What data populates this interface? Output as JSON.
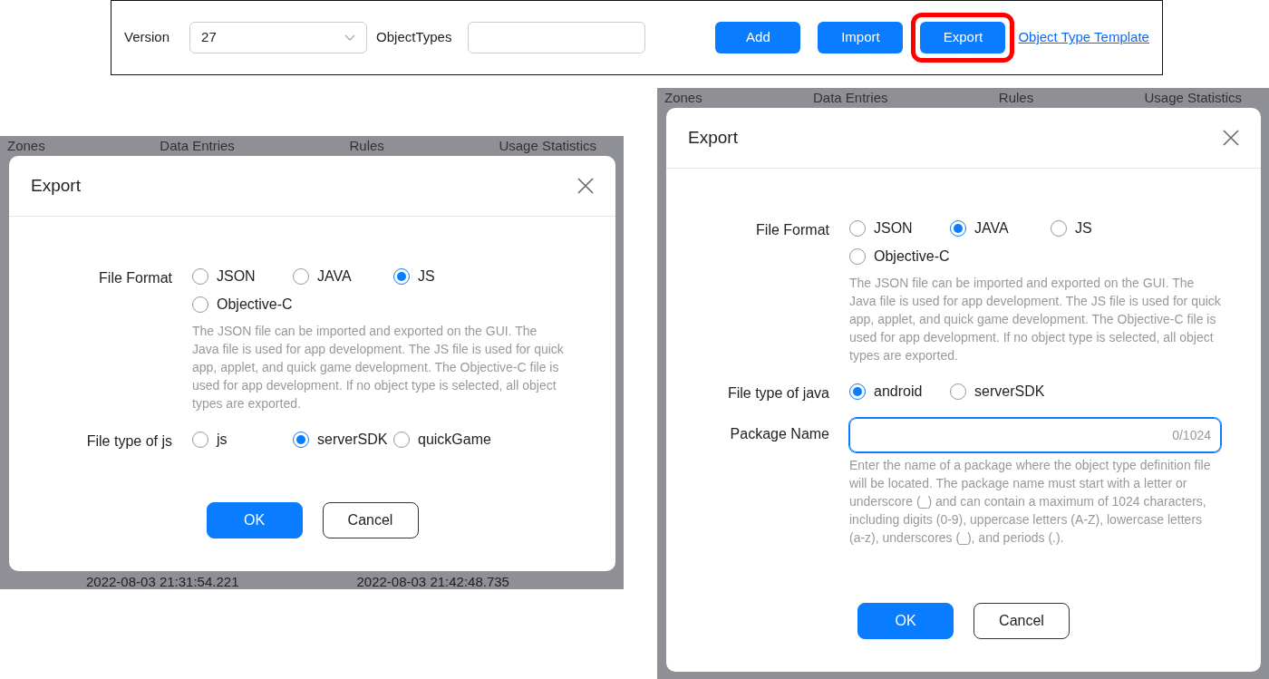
{
  "toolbar": {
    "version_label": "Version",
    "version_value": "27",
    "object_types_label": "ObjectTypes",
    "buttons": [
      {
        "label": "Add",
        "highlighted": false
      },
      {
        "label": "Import",
        "highlighted": false
      },
      {
        "label": "Export",
        "highlighted": true
      }
    ],
    "template_link": "Object Type Template"
  },
  "dialogs": [
    {
      "background_tabs": [
        "Zones",
        "Data Entries",
        "Rules",
        "Usage Statistics"
      ],
      "title": "Export",
      "fields": [
        {
          "kind": "radio",
          "label": "File Format",
          "options": [
            {
              "label": "JSON",
              "selected": false
            },
            {
              "label": "JAVA",
              "selected": false
            },
            {
              "label": "JS",
              "selected": true
            },
            {
              "label": "Objective-C",
              "selected": false
            }
          ],
          "help": "The JSON file can be imported and exported on the GUI. The Java file is used for app development. The JS file is used for quick app, applet, and quick game development. The Objective-C file is used for app development. If no object type is selected, all object types are exported."
        },
        {
          "kind": "radio",
          "label": "File type of js",
          "options": [
            {
              "label": "js",
              "selected": false
            },
            {
              "label": "serverSDK",
              "selected": true
            },
            {
              "label": "quickGame",
              "selected": false
            }
          ]
        }
      ],
      "buttons": [
        {
          "label": "OK",
          "kind": "primary"
        },
        {
          "label": "Cancel",
          "kind": "secondary"
        }
      ],
      "background_cells": [
        "2022-08-03 21:31:54.221",
        "2022-08-03 21:42:48.735"
      ]
    },
    {
      "background_tabs": [
        "Zones",
        "Data Entries",
        "Rules",
        "Usage Statistics"
      ],
      "title": "Export",
      "fields": [
        {
          "kind": "radio",
          "label": "File Format",
          "options": [
            {
              "label": "JSON",
              "selected": false
            },
            {
              "label": "JAVA",
              "selected": true
            },
            {
              "label": "JS",
              "selected": false
            },
            {
              "label": "Objective-C",
              "selected": false
            }
          ],
          "help": "The JSON file can be imported and exported on the GUI. The Java file is used for app development. The JS file is used for quick app, applet, and quick game development. The Objective-C file is used for app development. If no object type is selected, all object types are exported."
        },
        {
          "kind": "radio",
          "label": "File type of java",
          "options": [
            {
              "label": "android",
              "selected": true
            },
            {
              "label": "serverSDK",
              "selected": false
            }
          ]
        },
        {
          "kind": "text",
          "label": "Package Name",
          "counter": "0/1024",
          "focused": true,
          "help": "Enter the name of a package where the object type definition file will be located. The package name must start with a letter or underscore (_) and can contain a maximum of 1024 characters, including digits (0-9), uppercase letters (A-Z), lowercase letters (a-z), underscores (_), and periods (.)."
        }
      ],
      "buttons": [
        {
          "label": "OK",
          "kind": "primary"
        },
        {
          "label": "Cancel",
          "kind": "secondary"
        }
      ]
    }
  ]
}
